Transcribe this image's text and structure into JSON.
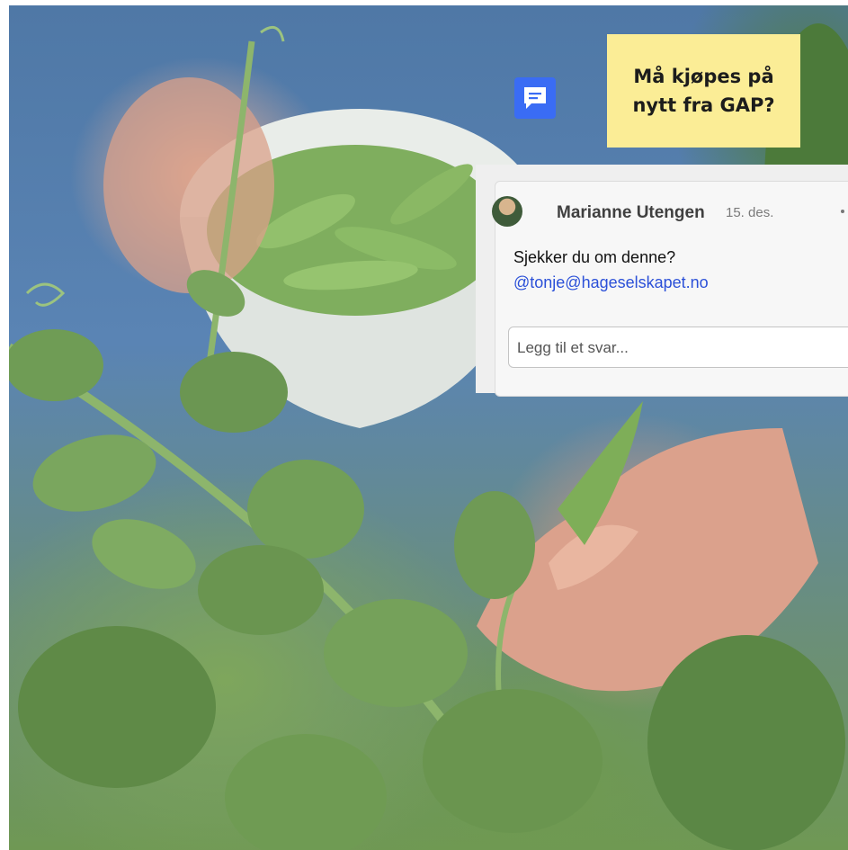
{
  "sticky_note": {
    "line1": "Må kjøpes på",
    "line2": "nytt fra GAP?",
    "color": "#fbed96"
  },
  "comment_icon": {
    "name": "comment-icon",
    "color": "#3a6cf4"
  },
  "comment": {
    "author": "Marianne Utengen",
    "date": "15. des.",
    "text": "Sjekker du om denne?",
    "mention": "@tonje@hageselskapet.no",
    "mention_color": "#2b50d8",
    "reply_placeholder": "Legg til et svar..."
  }
}
